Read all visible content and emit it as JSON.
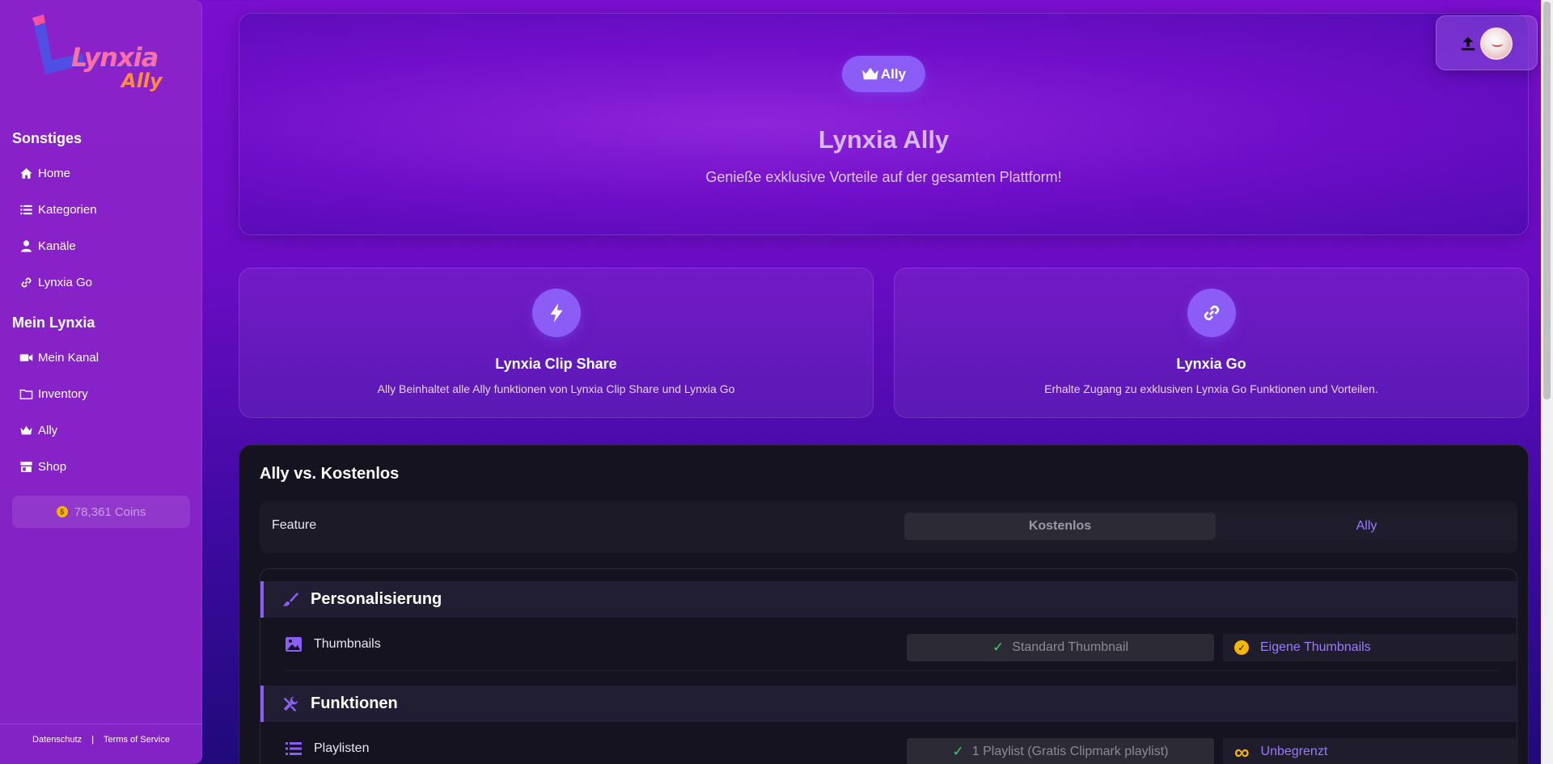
{
  "sidebar": {
    "logo": {
      "word": "Lynxia",
      "sub": "Ally"
    },
    "sections": [
      {
        "title": "Sonstiges"
      },
      {
        "title": "Mein Lynxia"
      }
    ],
    "items": [
      {
        "label": "Home",
        "icon": "home-icon"
      },
      {
        "label": "Kategorien",
        "icon": "list-icon"
      },
      {
        "label": "Kanäle",
        "icon": "user-icon"
      },
      {
        "label": "Lynxia Go",
        "icon": "link-icon"
      },
      {
        "label": "Mein Kanal",
        "icon": "video-icon"
      },
      {
        "label": "Inventory",
        "icon": "folder-icon"
      },
      {
        "label": "Ally",
        "icon": "crown-icon"
      },
      {
        "label": "Shop",
        "icon": "store-icon"
      }
    ],
    "coins": "78,361 Coins",
    "footer": {
      "privacy": "Datenschutz",
      "separator": "|",
      "terms": "Terms of Service"
    }
  },
  "hero": {
    "badge": "Ally",
    "title": "Lynxia Ally",
    "subtitle": "Genieße exklusive Vorteile auf der gesamten Plattform!"
  },
  "cards": [
    {
      "title": "Lynxia Clip Share",
      "desc": "Ally Beinhaltet alle Ally funktionen von Lynxia Clip Share und Lynxia Go",
      "icon": "bolt-icon"
    },
    {
      "title": "Lynxia Go",
      "desc": "Erhalte Zugang zu exklusiven Lynxia Go Funktionen und Vorteilen.",
      "icon": "link-icon"
    }
  ],
  "compare": {
    "title": "Ally vs. Kostenlos",
    "header": {
      "feature": "Feature",
      "free": "Kostenlos",
      "ally": "Ally"
    },
    "categories": [
      {
        "label": "Personalisierung",
        "icon": "paintbrush-icon",
        "rows": [
          {
            "label": "Thumbnails",
            "icon": "image-icon",
            "free": "Standard Thumbnail",
            "ally": "Eigene Thumbnails",
            "ally_icon": "check-circle-icon"
          }
        ]
      },
      {
        "label": "Funktionen",
        "icon": "tools-icon",
        "rows": [
          {
            "label": "Playlisten",
            "icon": "list-icon",
            "free": "1 Playlist (Gratis Clipmark playlist)",
            "ally": "Unbegrenzt",
            "ally_icon": "infinity-icon"
          }
        ]
      }
    ]
  },
  "colors": {
    "accent": "#8b5cf6",
    "gold": "#f5b400",
    "check": "#3ecf6e",
    "panel": "#15131f"
  }
}
